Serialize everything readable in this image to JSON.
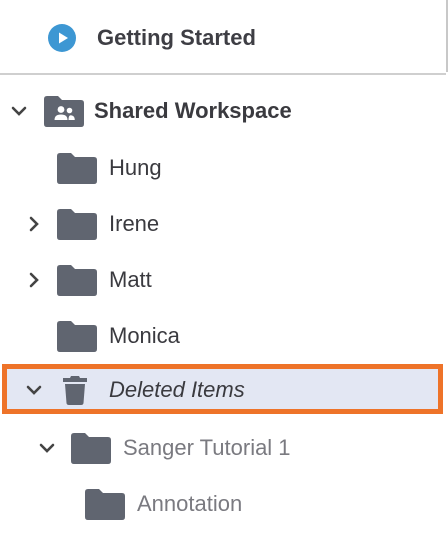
{
  "top": {
    "getting_started_label": "Getting Started"
  },
  "tree": {
    "workspace_label": "Shared Workspace",
    "folders": [
      {
        "label": "Hung"
      },
      {
        "label": "Irene"
      },
      {
        "label": "Matt"
      },
      {
        "label": "Monica"
      }
    ],
    "deleted": {
      "label": "Deleted Items",
      "children": [
        {
          "label": "Sanger Tutorial 1",
          "children": [
            {
              "label": "Annotation"
            }
          ]
        }
      ]
    }
  },
  "colors": {
    "highlight_border": "#ee7329",
    "highlight_fill": "#e3e7f3",
    "play_icon": "#3d97d3",
    "folder_icon": "#606570"
  },
  "icons": [
    "play-circle-icon",
    "people-folder-icon",
    "folder-icon",
    "trash-icon",
    "chevron-down-icon",
    "chevron-right-icon"
  ]
}
